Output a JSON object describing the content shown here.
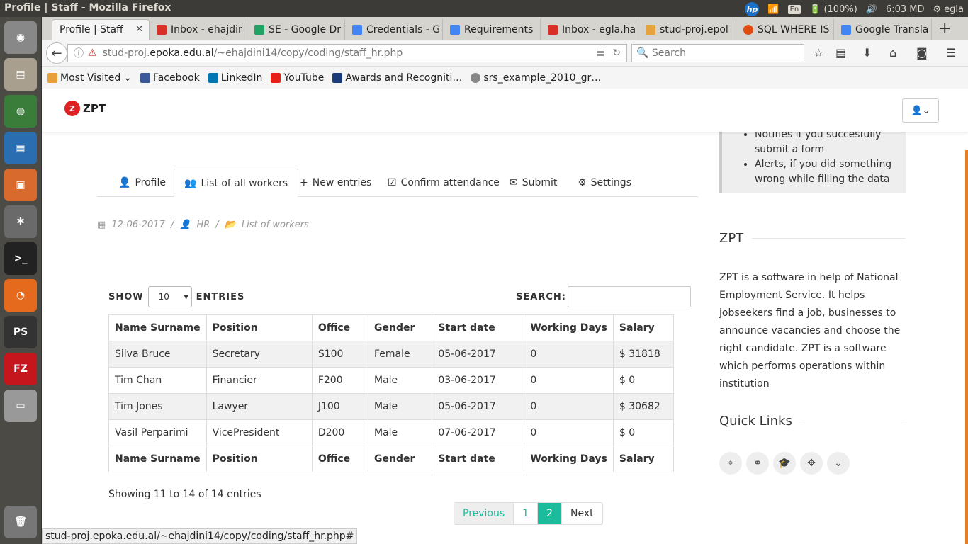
{
  "os": {
    "window_title": "Profile | Staff - Mozilla Firefox",
    "keyboard": "En",
    "battery": "(100%)",
    "clock": "6:03 MD",
    "user": "egla"
  },
  "tabs": [
    {
      "label": "Profile | Staff",
      "color": "#f5f5f5",
      "active": true
    },
    {
      "label": "Inbox - ehajdir",
      "color": "#d93025"
    },
    {
      "label": "SE - Google Dr",
      "color": "#1fa463"
    },
    {
      "label": "Credentials - G",
      "color": "#4285f4"
    },
    {
      "label": "Requirements",
      "color": "#4285f4"
    },
    {
      "label": "Inbox - egla.ha",
      "color": "#d93025"
    },
    {
      "label": "stud-proj.epol",
      "color": "#e6a23c"
    },
    {
      "label": "SQL WHERE IS",
      "color": "#e04b10"
    },
    {
      "label": "Google Transla",
      "color": "#4285f4"
    }
  ],
  "nav": {
    "url_prefix": "stud-proj.",
    "url_domain": "epoka.edu.al",
    "url_path": "/~ehajdini14/copy/coding/staff_hr.php",
    "search_placeholder": "Search"
  },
  "bookmarks": [
    "Most Visited",
    "Facebook",
    "LinkedIn",
    "YouTube",
    "Awards and Recogniti…",
    "srs_example_2010_gr…"
  ],
  "site": {
    "logo": "ZPT"
  },
  "page_tabs": [
    "Profile",
    "List of all workers",
    "New entries",
    "Confirm attendance",
    "Submit",
    "Settings"
  ],
  "breadcrumb": {
    "date": "12-06-2017",
    "role": "HR",
    "section": "List of workers"
  },
  "controls": {
    "show": "SHOW",
    "entries": "ENTRIES",
    "page_size": "10",
    "search": "SEARCH:"
  },
  "table": {
    "headers": [
      "Name Surname",
      "Position",
      "Office",
      "Gender",
      "Start date",
      "Working Days",
      "Salary"
    ],
    "rows": [
      [
        "Silva Bruce",
        "Secretary",
        "S100",
        "Female",
        "05-06-2017",
        "0",
        "$ 31818"
      ],
      [
        "Tim Chan",
        "Financier",
        "F200",
        "Male",
        "03-06-2017",
        "0",
        "$ 0"
      ],
      [
        "Tim Jones",
        "Lawyer",
        "J100",
        "Male",
        "05-06-2017",
        "0",
        "$ 30682"
      ],
      [
        "Vasil Perparimi",
        "VicePresident",
        "D200",
        "Male",
        "07-06-2017",
        "0",
        "$ 0"
      ]
    ]
  },
  "info": "Showing 11 to 14 of 14 entries",
  "pager": {
    "previous": "Previous",
    "p1": "1",
    "p2": "2",
    "next": "Next"
  },
  "sidebar": {
    "alerts": [
      "Notifies if you succesfully submit a form",
      "Alerts, if you did something wrong while filling the data"
    ],
    "about_title": "ZPT",
    "about_text": "ZPT is a software in help of National Employment Service. It helps jobseekers find a job, businesses to announce vacancies and choose the right candidate. ZPT is a software which performs operations within institution",
    "links_title": "Quick Links"
  },
  "statusbar": "stud-proj.epoka.edu.al/~ehajdini14/copy/coding/staff_hr.php#"
}
